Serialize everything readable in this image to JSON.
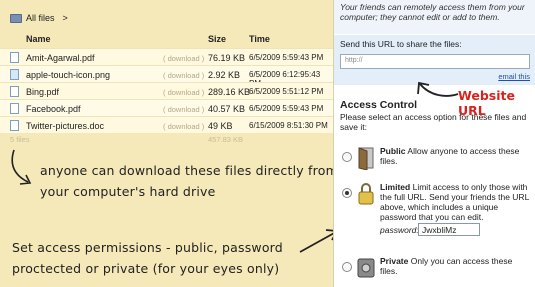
{
  "breadcrumb": {
    "label": "All files",
    "separator": ">"
  },
  "columns": {
    "name": "Name",
    "size": "Size",
    "time": "Time"
  },
  "files": [
    {
      "name": "Amit-Agarwal.pdf",
      "download": "( download )",
      "size": "76.19 KB",
      "time": "6/5/2009 5:59:43 PM",
      "icon": "pdf-file-icon"
    },
    {
      "name": "apple-touch-icon.png",
      "download": "( download )",
      "size": "2.92 KB",
      "time": "6/5/2009 6:12:95:43 PM",
      "icon": "image-file-icon"
    },
    {
      "name": "Bing.pdf",
      "download": "( download )",
      "size": "289.16 KB",
      "time": "6/5/2009 5:51:12 PM",
      "icon": "pdf-file-icon"
    },
    {
      "name": "Facebook.pdf",
      "download": "( download )",
      "size": "40.57 KB",
      "time": "6/5/2009 5:59:43 PM",
      "icon": "pdf-file-icon"
    },
    {
      "name": "Twitter-pictures.doc",
      "download": "( download )",
      "size": "49 KB",
      "time": "6/15/2009 8:51:30 PM",
      "icon": "doc-file-icon"
    }
  ],
  "summary": {
    "count": "5 files",
    "total": "457.83 KB"
  },
  "notes": {
    "download_note": "anyone can download these files directly from your computer's hard drive",
    "permission_note": "Set access permissions - public, password proctected or private (for your eyes only)",
    "website_url_note": "Website URL"
  },
  "share": {
    "intro": "Your friends can remotely access them from your computer; they cannot edit or add to them.",
    "url_label": "Send this URL to share the files:",
    "url_value": "http://",
    "email_link": "email this"
  },
  "access": {
    "title": "Access Control",
    "description": "Please select an access option for these files and save it:",
    "options": [
      {
        "label": "Public",
        "text": "Allow anyone to access these files.",
        "selected": false
      },
      {
        "label": "Limited",
        "text": "Limit access to only those with the full URL. Send your friends the URL above, which includes a unique password that you can edit.",
        "selected": true
      },
      {
        "label": "Private",
        "text": "Only you can access these files.",
        "selected": false
      }
    ],
    "password_label": "password:",
    "password_value": "JwxbliMz"
  },
  "colors": {
    "panel_bg": "#f5e8b9",
    "share_bg": "#e3eef8",
    "accent_red": "#d5231f",
    "link_blue": "#1f4fa8"
  }
}
